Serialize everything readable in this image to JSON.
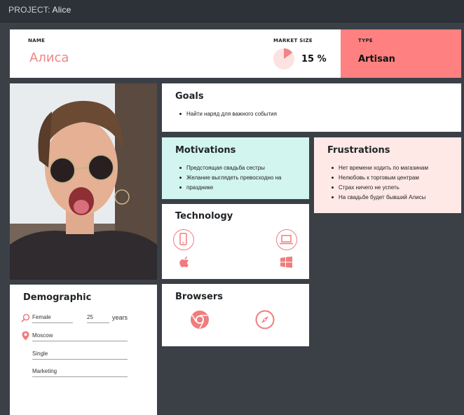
{
  "app": {
    "project_label": "PROJECT:",
    "project_name": "Alice"
  },
  "header": {
    "name_label": "NAME",
    "name_value": "Алиса",
    "market_label": "MARKET SIZE",
    "market_value": "15 %",
    "market_fraction": 0.15,
    "type_label": "TYPE",
    "type_value": "Artisan"
  },
  "goals": {
    "title": "Goals",
    "items": [
      "Найти наряд для важного события"
    ]
  },
  "motivations": {
    "title": "Motivations",
    "items": [
      "Предстоящая свадьба сестры",
      "Желание выглядеть превосходно на",
      "празднике"
    ]
  },
  "frustrations": {
    "title": "Frustrations",
    "items": [
      "Нет времени ходить по магазинам",
      "Нелюбовь к торговым центрам",
      "Страх ничего не успеть",
      "На свадьбе будет бывший Алисы"
    ]
  },
  "technology": {
    "title": "Technology",
    "icons": [
      "mobile-icon",
      "laptop-icon",
      "apple-icon",
      "windows-icon"
    ]
  },
  "browsers": {
    "title": "Browsers",
    "icons": [
      "chrome-icon",
      "safari-icon"
    ]
  },
  "demographic": {
    "title": "Demographic",
    "gender": "Female",
    "age": "25",
    "age_unit": "years",
    "location": "Moscow",
    "status": "Single",
    "occupation": "Marketing"
  },
  "colors": {
    "accent": "#f07c7c",
    "type_bg": "#ff8080",
    "motivations_bg": "#d2f5ef",
    "frustrations_bg": "#ffe9e6",
    "background": "#3b4047"
  }
}
